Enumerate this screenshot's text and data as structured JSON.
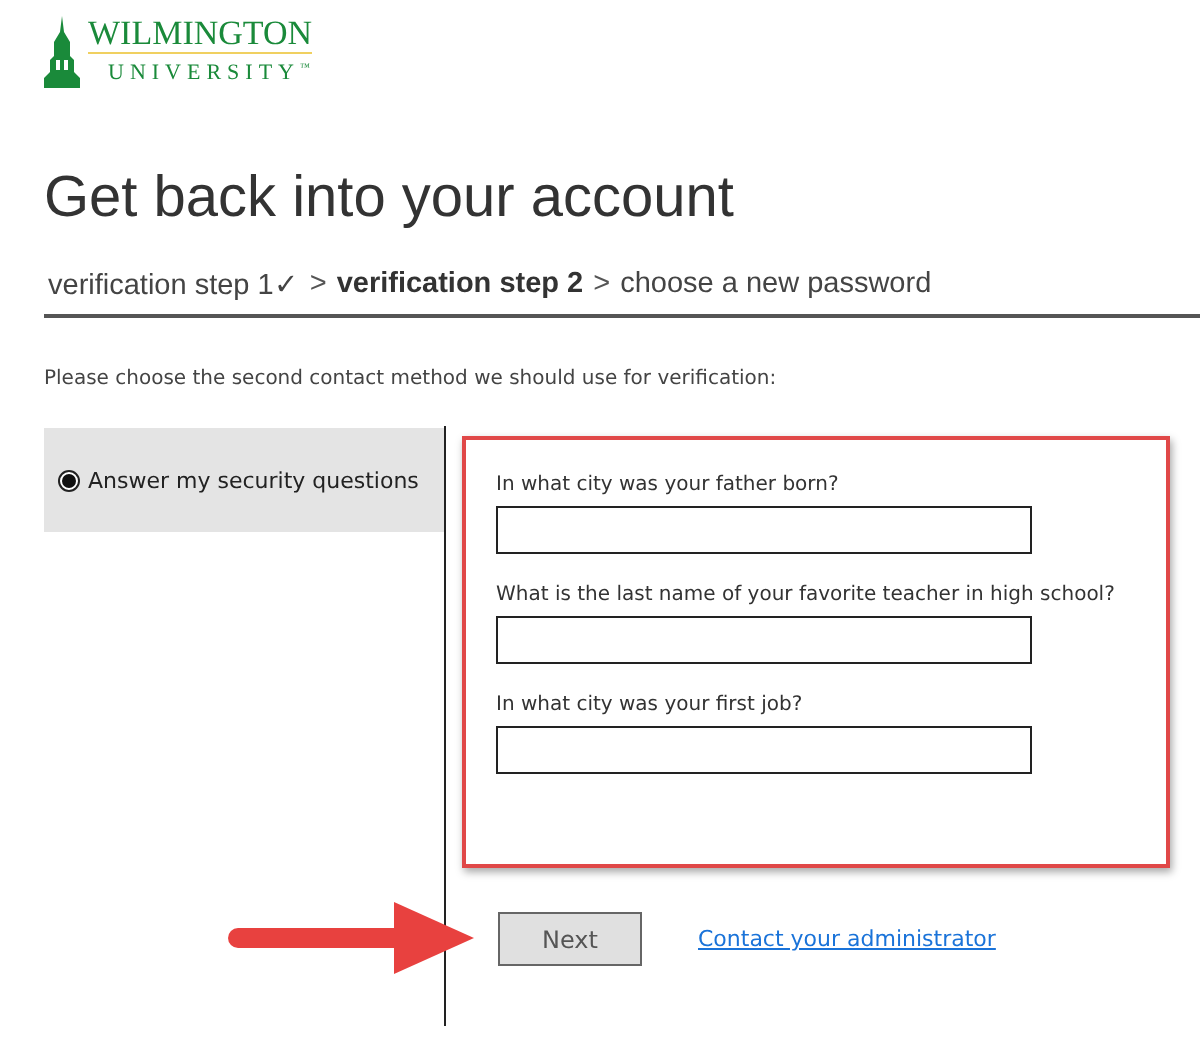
{
  "logo": {
    "name": "WILMINGTON",
    "subtitle": "UNIVERSITY",
    "mark": "™"
  },
  "title": "Get back into your account",
  "breadcrumb": [
    {
      "kind": "step",
      "label": "verification step 1",
      "check": "✓",
      "selected": false
    },
    {
      "kind": "separator",
      "label": ">"
    },
    {
      "kind": "step",
      "label": "verification step 2",
      "selected": true
    },
    {
      "kind": "separator",
      "label": ">"
    },
    {
      "kind": "step",
      "label": "choose a new password",
      "selected": false
    }
  ],
  "instruction": "Please choose the second contact method we should use for verification:",
  "methods": [
    {
      "label": "Answer my security questions",
      "selected": true
    }
  ],
  "questions": [
    {
      "label": "In what city was your father born?"
    },
    {
      "label": "What is the last name of your favorite teacher in high school?"
    },
    {
      "label": "In what city was your first job?"
    }
  ],
  "next_button": "Next",
  "admin_link": "Contact your administrator"
}
